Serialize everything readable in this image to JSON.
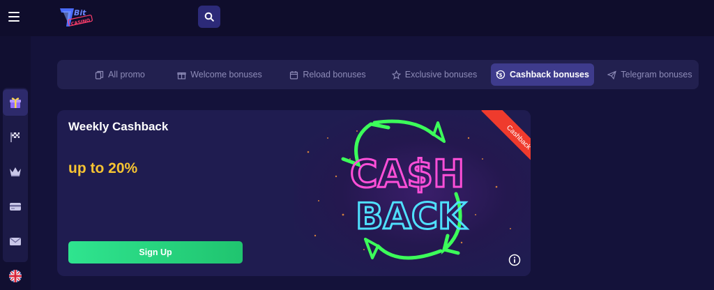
{
  "header": {
    "logo_text": "Bit Casino",
    "menu_icon": "hamburger-menu-icon",
    "search_icon": "search-icon"
  },
  "sidebar": {
    "items": [
      {
        "icon": "gift-icon",
        "active": true
      },
      {
        "icon": "racing-flag-icon",
        "active": false
      },
      {
        "icon": "crown-icon",
        "active": false
      },
      {
        "icon": "payment-card-icon",
        "active": false
      },
      {
        "icon": "envelope-icon",
        "active": false
      },
      {
        "icon": "uk-flag-icon",
        "active": false
      }
    ]
  },
  "promo_tabs": [
    {
      "label": "All promo",
      "icon": "copy-icon",
      "active": false
    },
    {
      "label": "Welcome bonuses",
      "icon": "gift-icon",
      "active": false
    },
    {
      "label": "Reload bonuses",
      "icon": "calendar-icon",
      "active": false
    },
    {
      "label": "Exclusive bonuses",
      "icon": "star-icon",
      "active": false
    },
    {
      "label": "Cashback bonuses",
      "icon": "cashback-icon",
      "active": true
    },
    {
      "label": "Telegram bonuses",
      "icon": "paper-plane-icon",
      "active": false
    }
  ],
  "promo_card": {
    "title": "Weekly Cashback",
    "amount": "up to 20%",
    "cta": "Sign Up",
    "ribbon": "Cashback",
    "art_line1": "CA$H",
    "art_line2": "BACK"
  },
  "colors": {
    "background": "#14123a",
    "accent_green": "#2fe48f",
    "amount_yellow": "#f7c432",
    "ribbon_red": "#ef3b2d",
    "active_tab": "#3e3b8c",
    "neon_pink": "#ff4fd8",
    "neon_cyan": "#4fe0ff",
    "neon_green": "#3cff5a"
  }
}
